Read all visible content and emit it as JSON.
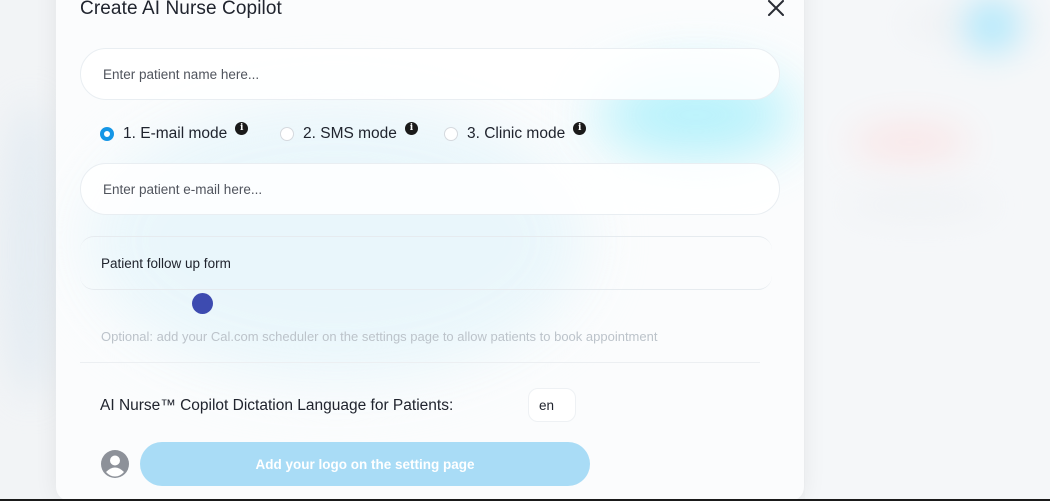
{
  "modal": {
    "title": "Create AI Nurse Copilot"
  },
  "patient_name": {
    "placeholder": "Enter patient name here...",
    "value": ""
  },
  "modes": [
    {
      "label": "1. E-mail mode",
      "selected": true,
      "info_icon": "info-icon"
    },
    {
      "label": "2. SMS mode",
      "selected": false,
      "info_icon": "info-icon"
    },
    {
      "label": "3. Clinic mode",
      "selected": false,
      "info_icon": "info-icon"
    }
  ],
  "patient_email": {
    "placeholder": "Enter patient e-mail here...",
    "value": ""
  },
  "followup": {
    "label": "Patient follow up form"
  },
  "optional_note": "Optional: add your Cal.com scheduler on the settings page to allow patients to book appointment",
  "dictation": {
    "label": "AI Nurse™ Copilot Dictation Language for Patients:",
    "value": "en"
  },
  "logo_button": {
    "label": "Add your logo on the setting page"
  },
  "icons": {
    "close": "close-icon",
    "avatar": "avatar-icon"
  },
  "colors": {
    "accent": "#1596e6",
    "button": "#a9dcf6",
    "cursor": "#3d4bb0"
  }
}
